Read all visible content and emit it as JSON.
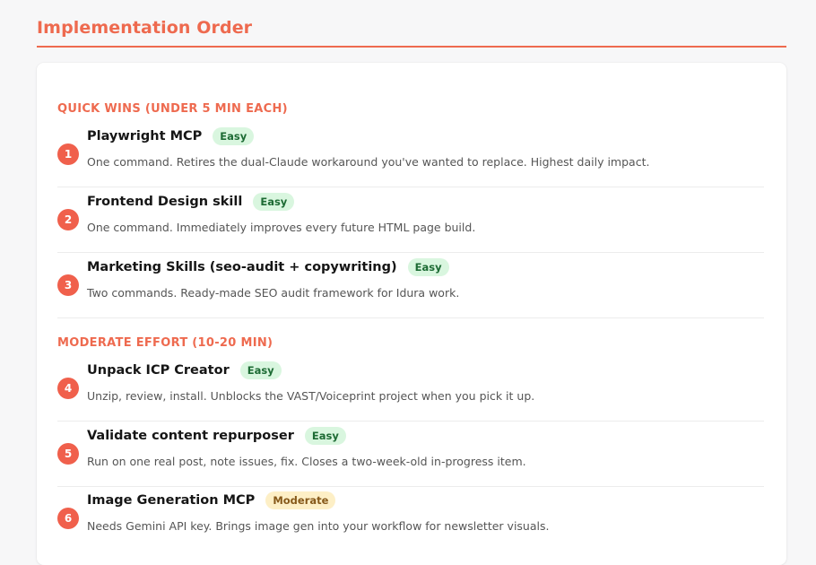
{
  "page": {
    "title": "Implementation Order"
  },
  "sections": [
    {
      "heading": "QUICK WINS (UNDER 5 MIN EACH)",
      "items": [
        {
          "number": "1",
          "title": "Playwright MCP",
          "badge": "Easy",
          "description": "One command. Retires the dual-Claude workaround you've wanted to replace. Highest daily impact."
        },
        {
          "number": "2",
          "title": "Frontend Design skill",
          "badge": "Easy",
          "description": "One command. Immediately improves every future HTML page build."
        },
        {
          "number": "3",
          "title": "Marketing Skills (seo-audit + copywriting)",
          "badge": "Easy",
          "description": "Two commands. Ready-made SEO audit framework for Idura work."
        }
      ]
    },
    {
      "heading": "MODERATE EFFORT (10-20 MIN)",
      "items": [
        {
          "number": "4",
          "title": "Unpack ICP Creator",
          "badge": "Easy",
          "description": "Unzip, review, install. Unblocks the VAST/Voiceprint project when you pick it up."
        },
        {
          "number": "5",
          "title": "Validate content repurposer",
          "badge": "Easy",
          "description": "Run on one real post, note issues, fix. Closes a two-week-old in-progress item."
        },
        {
          "number": "6",
          "title": "Image Generation MCP",
          "badge": "Moderate",
          "description": "Needs Gemini API key. Brings image gen into your workflow for newsletter visuals."
        }
      ]
    }
  ],
  "colors": {
    "accent": "#ee6a4f",
    "badge_easy_bg": "#d9f6df",
    "badge_easy_text": "#1d6b34",
    "badge_moderate_bg": "#fdefc6",
    "badge_moderate_text": "#86591a"
  }
}
